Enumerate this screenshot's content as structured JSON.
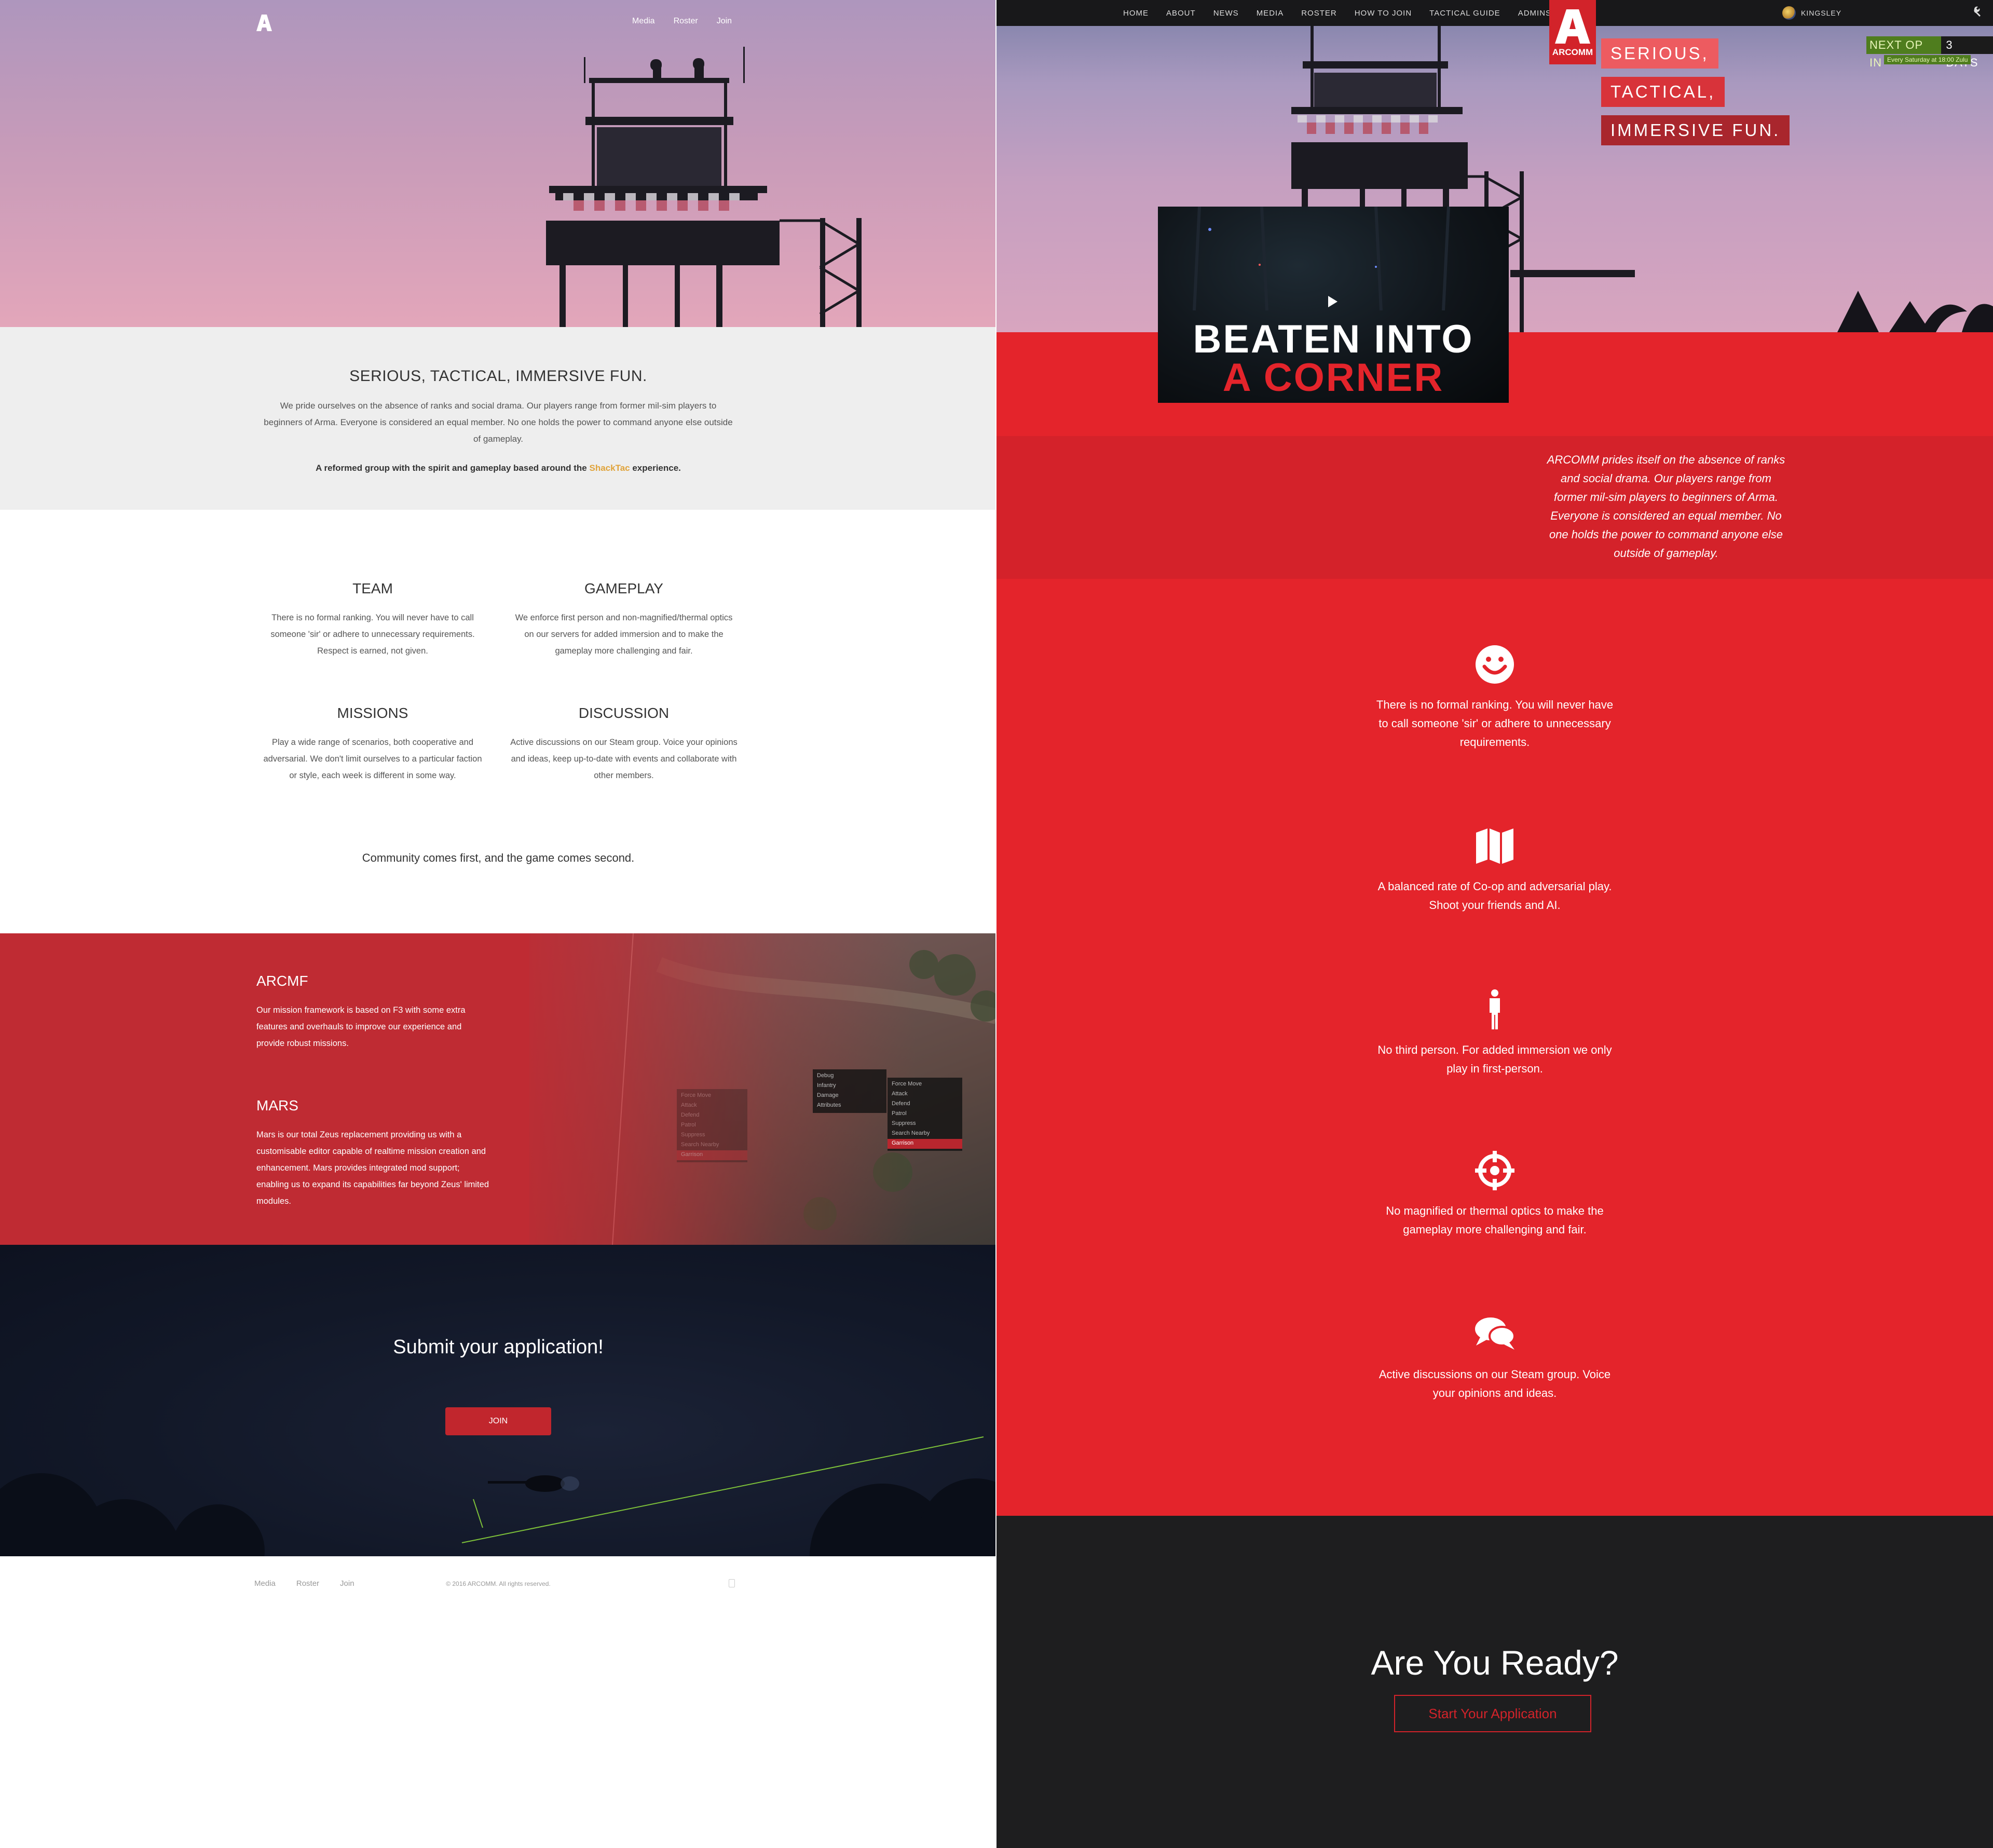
{
  "left": {
    "nav": [
      "Media",
      "Roster",
      "Join"
    ],
    "intro": {
      "heading": "SERIOUS, TACTICAL, IMMERSIVE FUN.",
      "body": "We pride ourselves on the absence of ranks and social drama. Our players range from former mil-sim players to beginners of Arma. Everyone is considered an equal member. No one holds the power to command anyone else outside of gameplay.",
      "ref_before": "A reformed group with the spirit and gameplay based around the",
      "ref_link": "ShackTac",
      "ref_after": "experience."
    },
    "features": [
      {
        "title": "TEAM",
        "text": "There is no formal ranking. You will never have to call someone 'sir' or adhere to unnecessary requirements. Respect is earned, not given."
      },
      {
        "title": "GAMEPLAY",
        "text": "We enforce first person and non-magnified/thermal optics on our servers for added immersion and to make the gameplay more challenging and fair."
      },
      {
        "title": "MISSIONS",
        "text": "Play a wide range of scenarios, both cooperative and adversarial. We don't limit ourselves to a particular faction or style, each week is different in some way."
      },
      {
        "title": "DISCUSSION",
        "text": "Active discussions on our Steam group. Voice your opinions and ideas, keep up-to-date with events and collaborate with other members."
      }
    ],
    "tagline": "Community comes first, and the game comes second.",
    "framework": [
      {
        "title": "ARCMF",
        "text": "Our mission framework is based on F3 with some extra features and overhauls to improve our experience and provide robust missions."
      },
      {
        "title": "MARS",
        "text": "Mars is our total Zeus replacement providing us with a customisable editor capable of realtime mission creation and enhancement. Mars provides integrated mod support; enabling us to expand its capabilities far beyond Zeus' limited modules."
      }
    ],
    "menu_a": [
      "Debug",
      "Infantry",
      "Damage",
      "Attributes"
    ],
    "menu_b": [
      "Force Move",
      "Attack",
      "Defend",
      "Patrol",
      "Suppress",
      "Search Nearby",
      "Garrison"
    ],
    "menu_c": [
      "Force Move",
      "Attack",
      "Defend",
      "Patrol",
      "Suppress",
      "Search Nearby",
      "Garrison"
    ],
    "join": {
      "heading": "Submit your application!",
      "button": "JOIN"
    },
    "footer": {
      "nav": [
        "Media",
        "Roster",
        "Join"
      ],
      "copyright": "© 2016 ARCOMM. All rights reserved."
    }
  },
  "right": {
    "nav": [
      "HOME",
      "ABOUT",
      "NEWS",
      "MEDIA",
      "ROSTER",
      "HOW TO JOIN",
      "TACTICAL GUIDE",
      "ADMINS"
    ],
    "user": "KINGSLEY",
    "logo_text": "ARCOMM",
    "slogans": [
      "SERIOUS,",
      "TACTICAL,",
      "IMMERSIVE FUN."
    ],
    "next_op": {
      "label": "NEXT OP IN",
      "value": "3 DAYS",
      "sub": "Every Saturday at 18:00 Zulu"
    },
    "video": {
      "line1": "BEATEN INTO",
      "line2": "A CORNER"
    },
    "about": "ARCOMM prides itself on the absence of ranks and social drama. Our players range from former mil-sim players to beginners of Arma. Everyone is considered an equal member. No one holds the power to command anyone else outside of gameplay.",
    "features": [
      {
        "icon": "smile-icon",
        "text": "There is no formal ranking. You will never have to call someone 'sir' or adhere to unnecessary requirements."
      },
      {
        "icon": "map-icon",
        "text": "A balanced rate of Co-op and adversarial play. Shoot your friends and AI."
      },
      {
        "icon": "person-icon",
        "text": "No third person. For added immersion we only play in first-person."
      },
      {
        "icon": "crosshair-icon",
        "text": "No magnified or thermal optics to make the gameplay more challenging and fair."
      },
      {
        "icon": "chat-icon",
        "text": "Active discussions on our Steam group. Voice your opinions and ideas."
      }
    ],
    "ready": {
      "heading": "Are You Ready?",
      "button": "Start Your Application"
    }
  },
  "colors": {
    "accent_red": "#e4242b",
    "dark_red": "#d4222a",
    "navy": "#121828",
    "green": "#4f7d1e",
    "link_gold": "#e0a33a"
  }
}
